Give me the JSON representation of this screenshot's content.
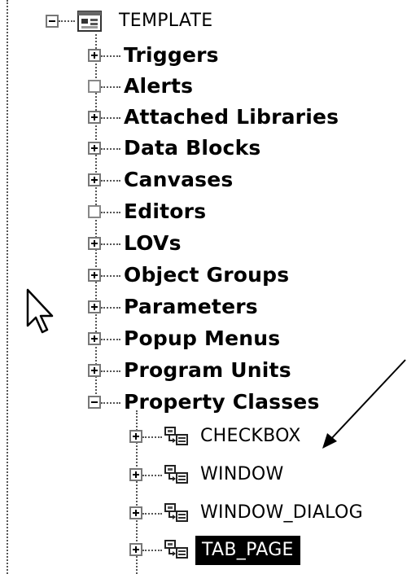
{
  "tree": {
    "root": {
      "label": "TEMPLATE",
      "icon": "form-module-icon"
    },
    "nodes": [
      {
        "label": "Triggers",
        "expander": "plus"
      },
      {
        "label": "Alerts",
        "expander": "empty"
      },
      {
        "label": "Attached Libraries",
        "expander": "plus"
      },
      {
        "label": "Data Blocks",
        "expander": "plus"
      },
      {
        "label": "Canvases",
        "expander": "plus"
      },
      {
        "label": "Editors",
        "expander": "empty"
      },
      {
        "label": "LOVs",
        "expander": "plus"
      },
      {
        "label": "Object Groups",
        "expander": "plus"
      },
      {
        "label": "Parameters",
        "expander": "plus"
      },
      {
        "label": "Popup Menus",
        "expander": "plus"
      },
      {
        "label": "Program Units",
        "expander": "plus"
      },
      {
        "label": "Property Classes",
        "expander": "minus"
      }
    ],
    "property_classes": [
      {
        "label": "CHECKBOX",
        "selected": false
      },
      {
        "label": "WINDOW",
        "selected": false
      },
      {
        "label": "WINDOW_DIALOG",
        "selected": false
      },
      {
        "label": "TAB_PAGE",
        "selected": true
      }
    ]
  },
  "overlay": {
    "cursor_icon": "mouse-pointer-icon",
    "arrow_icon": "annotation-arrow-icon"
  }
}
